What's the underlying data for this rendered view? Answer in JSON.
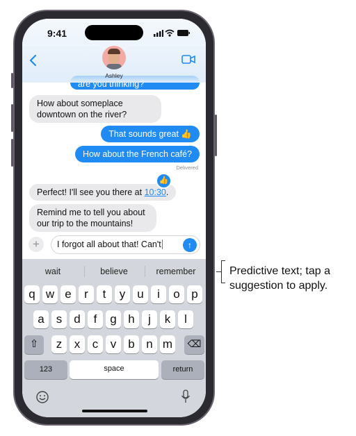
{
  "status_bar": {
    "time": "9:41"
  },
  "header": {
    "contact_name": "Ashley",
    "icons": [
      "back-chevron-icon",
      "avatar-memoji",
      "video-camera-icon"
    ]
  },
  "messages": [
    {
      "from": "me",
      "text": "are you thinking?",
      "partial": true
    },
    {
      "from": "them",
      "text": "How about someplace downtown on the river?"
    },
    {
      "from": "me",
      "text": "That sounds great 👍"
    },
    {
      "from": "me",
      "text": "How about the French café?"
    },
    {
      "status": "Delivered"
    },
    {
      "from": "them",
      "text_before": "Perfect! I'll see you there at ",
      "link": "10:30",
      "text_after": ".",
      "tapback": "thumbs-up"
    },
    {
      "from": "them",
      "text": "Remind me to tell you about our trip to the mountains!"
    }
  ],
  "composer": {
    "value": "I forgot all about that! Can't"
  },
  "keyboard": {
    "predictions": [
      "wait",
      "believe",
      "remember"
    ],
    "row1": [
      "q",
      "w",
      "e",
      "r",
      "t",
      "y",
      "u",
      "i",
      "o",
      "p"
    ],
    "row2": [
      "a",
      "s",
      "d",
      "f",
      "g",
      "h",
      "j",
      "k",
      "l"
    ],
    "row3": [
      "z",
      "x",
      "c",
      "v",
      "b",
      "n",
      "m"
    ],
    "numbers": "123",
    "space": "space",
    "return": "return"
  },
  "callout": {
    "line1": "Predictive text; tap a",
    "line2": "suggestion to apply."
  },
  "colors": {
    "accent": "#1f8bf3",
    "incoming": "#e9e9eb",
    "keyboard": "#d3d6dc"
  }
}
